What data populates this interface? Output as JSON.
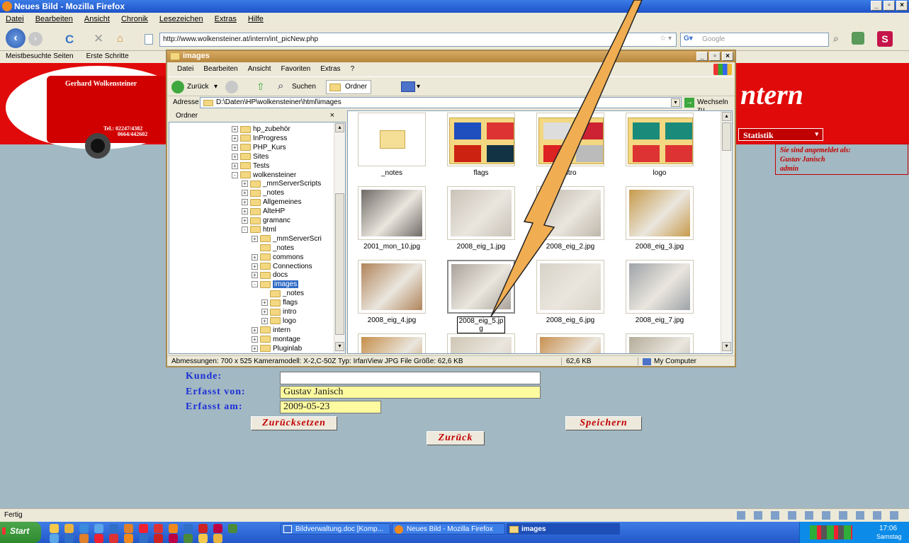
{
  "firefox": {
    "title": "Neues Bild - Mozilla Firefox",
    "menu": [
      "Datei",
      "Bearbeiten",
      "Ansicht",
      "Chronik",
      "Lesezeichen",
      "Extras",
      "Hilfe"
    ],
    "url": "http://www.wolkensteiner.at/intern/int_picNew.php",
    "search_placeholder": "Google",
    "bookmarks": [
      "Meistbesuchte Seiten",
      "Erste Schritte"
    ],
    "status": "Fertig"
  },
  "site": {
    "logo_name": "Gerhard Wolkensteiner",
    "logo_phone1": "Tel.: 02247/4382",
    "logo_phone2": "0664/442602",
    "header_word": "ntern",
    "nav_statistik": "Statistik",
    "user_line1": "Sie sind angemeldet als:",
    "user_line2": "Gustav Janisch",
    "user_line3": "admin",
    "form": {
      "kunde_label": "Kunde:",
      "kunde_value": "",
      "erfasst_von_label": "Erfasst von:",
      "erfasst_von_value": "Gustav Janisch",
      "erfasst_am_label": "Erfasst am:",
      "erfasst_am_value": "2009-05-23",
      "reset_button": "Zurücksetzen",
      "save_button": "Speichern",
      "back_button": "Zurück"
    }
  },
  "explorer": {
    "title": "images",
    "menu": [
      "Datei",
      "Bearbeiten",
      "Ansicht",
      "Favoriten",
      "Extras",
      "?"
    ],
    "toolbar": {
      "back": "Zurück",
      "search": "Suchen",
      "folders": "Ordner"
    },
    "address_label": "Adresse",
    "address": "D:\\Daten\\HP\\wolkensteiner\\html\\images",
    "go_button": "Wechseln zu",
    "tree_header": "Ordner",
    "tree": [
      {
        "label": "hp_zubehör",
        "depth": 0,
        "pm": "+"
      },
      {
        "label": "InProgress",
        "depth": 0,
        "pm": "+"
      },
      {
        "label": "PHP_Kurs",
        "depth": 0,
        "pm": "+"
      },
      {
        "label": "Sites",
        "depth": 0,
        "pm": "+"
      },
      {
        "label": "Tests",
        "depth": 0,
        "pm": "+"
      },
      {
        "label": "wolkensteiner",
        "depth": 0,
        "pm": "-"
      },
      {
        "label": "_mmServerScripts",
        "depth": 1,
        "pm": "+"
      },
      {
        "label": "_notes",
        "depth": 1,
        "pm": "+"
      },
      {
        "label": "Allgemeines",
        "depth": 1,
        "pm": "+"
      },
      {
        "label": "AlteHP",
        "depth": 1,
        "pm": "+"
      },
      {
        "label": "gramanc",
        "depth": 1,
        "pm": "+"
      },
      {
        "label": "html",
        "depth": 1,
        "pm": "-"
      },
      {
        "label": "_mmServerScri",
        "depth": 2,
        "pm": "+"
      },
      {
        "label": "_notes",
        "depth": 2,
        "pm": ""
      },
      {
        "label": "commons",
        "depth": 2,
        "pm": "+"
      },
      {
        "label": "Connections",
        "depth": 2,
        "pm": "+"
      },
      {
        "label": "docs",
        "depth": 2,
        "pm": "+"
      },
      {
        "label": "images",
        "depth": 2,
        "pm": "-",
        "selected": true
      },
      {
        "label": "_notes",
        "depth": 3,
        "pm": ""
      },
      {
        "label": "flags",
        "depth": 3,
        "pm": "+"
      },
      {
        "label": "intro",
        "depth": 3,
        "pm": "+"
      },
      {
        "label": "logo",
        "depth": 3,
        "pm": "+"
      },
      {
        "label": "intern",
        "depth": 2,
        "pm": "+"
      },
      {
        "label": "montage",
        "depth": 2,
        "pm": "+"
      },
      {
        "label": "Pluginlab",
        "depth": 2,
        "pm": "+"
      }
    ],
    "items": [
      {
        "label": "_notes",
        "kind": "folder"
      },
      {
        "label": "flags",
        "kind": "flags"
      },
      {
        "label": "ntro",
        "kind": "intro"
      },
      {
        "label": "logo",
        "kind": "logo"
      },
      {
        "label": "2001_mon_10.jpg",
        "kind": "photo",
        "tone": "#6f6a66"
      },
      {
        "label": "2008_eig_1.jpg",
        "kind": "photo",
        "tone": "#c9c2b8"
      },
      {
        "label": "2008_eig_2.jpg",
        "kind": "photo",
        "tone": "#bfb7ab"
      },
      {
        "label": "2008_eig_3.jpg",
        "kind": "photo",
        "tone": "#c79a4b"
      },
      {
        "label": "2008_eig_4.jpg",
        "kind": "photo",
        "tone": "#b0845a"
      },
      {
        "label": "2008_eig_5.jpg",
        "kind": "photo",
        "tone": "#a9a29a",
        "selected": true
      },
      {
        "label": "2008_eig_6.jpg",
        "kind": "photo",
        "tone": "#d8d3c8"
      },
      {
        "label": "2008_eig_7.jpg",
        "kind": "photo",
        "tone": "#9ea3a8"
      },
      {
        "label": "",
        "kind": "photo",
        "tone": "#c58e4a"
      },
      {
        "label": "",
        "kind": "photo",
        "tone": "#cfc6b4"
      },
      {
        "label": "",
        "kind": "photo",
        "tone": "#c89050"
      },
      {
        "label": "",
        "kind": "photo",
        "tone": "#b5ad9a"
      }
    ],
    "status_info": "Abmessungen: 700 x 525 Kameramodell: X-2,C-50Z Typ: IrfanView JPG File Größe: 62,6 KB",
    "status_size": "62,6 KB",
    "status_location": "My Computer"
  },
  "taskbar": {
    "start": "Start",
    "tasks": [
      "Bildverwaltung.doc [Komp...",
      "Neues Bild - Mozilla Firefox",
      "images"
    ],
    "time": "17:06",
    "day": "Samstag"
  }
}
